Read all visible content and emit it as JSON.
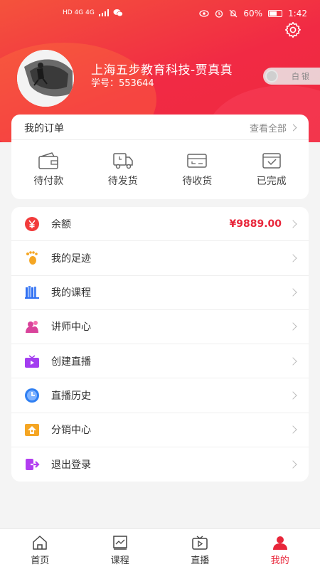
{
  "status_bar": {
    "network": "HD 4G 4G",
    "battery": "60%",
    "time": "1:42",
    "battery_level": 0.6
  },
  "profile": {
    "name": "上海五步教育科技-贾真真",
    "student_id": "学号：553644",
    "level_badge": "白银"
  },
  "orders": {
    "title": "我的订单",
    "view_all": "查看全部",
    "items": [
      {
        "label": "待付款",
        "icon": "wallet-icon"
      },
      {
        "label": "待发货",
        "icon": "delivery-truck-icon"
      },
      {
        "label": "待收货",
        "icon": "card-receive-icon"
      },
      {
        "label": "已完成",
        "icon": "check-box-icon"
      }
    ]
  },
  "menu": {
    "items": [
      {
        "label": "余额",
        "value": "¥9889.00",
        "icon": "balance-icon",
        "color": "#f23b3b"
      },
      {
        "label": "我的足迹",
        "icon": "footprint-icon",
        "color": "#f5a623"
      },
      {
        "label": "我的课程",
        "icon": "books-icon",
        "color": "#2f6ff2"
      },
      {
        "label": "讲师中心",
        "icon": "lecturer-icon",
        "color": "#d9439b"
      },
      {
        "label": "创建直播",
        "icon": "tv-icon",
        "color": "#a33df0"
      },
      {
        "label": "直播历史",
        "icon": "clock-icon",
        "color": "#2f7ff2"
      },
      {
        "label": "分销中心",
        "icon": "distribution-icon",
        "color": "#f5a623"
      },
      {
        "label": "退出登录",
        "icon": "logout-icon",
        "color": "#b23df0"
      }
    ]
  },
  "tabbar": {
    "tabs": [
      {
        "label": "首页",
        "icon": "home-icon"
      },
      {
        "label": "课程",
        "icon": "course-icon"
      },
      {
        "label": "直播",
        "icon": "live-icon"
      },
      {
        "label": "我的",
        "icon": "user-icon",
        "active": true
      }
    ]
  },
  "colors": {
    "accent": "#e8263a",
    "header_start": "#f4533c",
    "header_end": "#ef2a3e"
  }
}
